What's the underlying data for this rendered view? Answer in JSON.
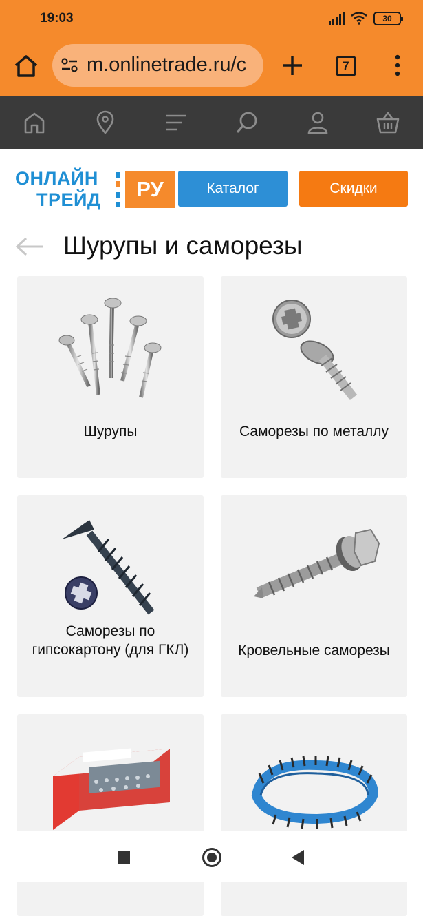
{
  "status_bar": {
    "time": "19:03",
    "battery": "30"
  },
  "browser": {
    "url": "m.onlinetrade.ru/c",
    "tab_count": "7"
  },
  "site_nav": {
    "items": [
      "home-icon",
      "location-pin-icon",
      "menu-lines-icon",
      "search-icon",
      "user-icon",
      "basket-icon"
    ]
  },
  "header": {
    "logo_line1": "ОНЛАЙН",
    "logo_line2": "ТРЕЙД",
    "logo_ru": "РУ",
    "catalog_label": "Каталог",
    "discount_label": "Скидки"
  },
  "page": {
    "title": "Шурупы и саморезы"
  },
  "categories": [
    {
      "label": "Шурупы"
    },
    {
      "label": "Саморезы по металлу"
    },
    {
      "label": "Саморезы по гипсокартону (для ГКЛ)"
    },
    {
      "label": "Кровельные саморезы"
    },
    {
      "label": ""
    },
    {
      "label": ""
    }
  ],
  "colors": {
    "chrome": "#f58a2c",
    "nav": "#3a3a3a",
    "brand_blue": "#1f8fd4",
    "catalog": "#2d8fd6",
    "discount": "#f57a12",
    "card": "#f2f2f2"
  }
}
